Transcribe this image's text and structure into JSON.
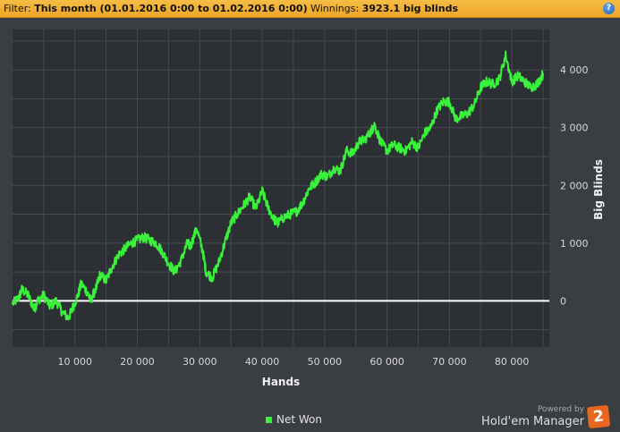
{
  "filter_bar": {
    "filter_label": "Filter:",
    "filter_value": "This month (01.01.2016 0:00 to 01.02.2016 0:00)",
    "winnings_label": "Winnings:",
    "winnings_value": "3923.1 big blinds",
    "help_glyph": "?"
  },
  "chart_data": {
    "type": "line",
    "xlabel": "Hands",
    "ylabel": "Big Blinds",
    "xlim": [
      0,
      86000
    ],
    "ylim": [
      -800,
      4700
    ],
    "x_ticks": [
      10000,
      20000,
      30000,
      40000,
      50000,
      60000,
      70000,
      80000
    ],
    "x_tick_labels": [
      "10 000",
      "20 000",
      "30 000",
      "40 000",
      "50 000",
      "60 000",
      "70 000",
      "80 000"
    ],
    "y_ticks": [
      0,
      1000,
      2000,
      3000,
      4000
    ],
    "y_tick_labels": [
      "0",
      "1 000",
      "2 000",
      "3 000",
      "4 000"
    ],
    "grid": true,
    "legend_position": "bottom-center",
    "series": [
      {
        "name": "Net Won",
        "color": "#39f23a",
        "x": [
          0,
          1000,
          1500,
          2500,
          3500,
          4000,
          5000,
          6000,
          7000,
          8000,
          9000,
          9500,
          10500,
          11000,
          12000,
          12500,
          13500,
          14000,
          15000,
          16000,
          17000,
          18000,
          19000,
          20000,
          21000,
          22000,
          23000,
          24000,
          25000,
          26000,
          27000,
          28000,
          28500,
          29500,
          30500,
          31000,
          32000,
          33000,
          34000,
          35000,
          36000,
          37000,
          38000,
          39000,
          40000,
          41000,
          42000,
          42500,
          43500,
          44500,
          45500,
          46500,
          47500,
          48500,
          49500,
          50500,
          51500,
          52500,
          53500,
          54500,
          55500,
          56500,
          57500,
          58000,
          59000,
          60000,
          61000,
          62000,
          63000,
          64000,
          65000,
          66000,
          67000,
          68000,
          69000,
          70000,
          71000,
          72000,
          73000,
          74000,
          75000,
          76000,
          77000,
          78000,
          79000,
          80000,
          81000,
          82000,
          83000,
          84000,
          85000
        ],
        "values": [
          -50,
          50,
          200,
          100,
          -150,
          0,
          100,
          -100,
          0,
          -200,
          -300,
          -150,
          100,
          300,
          150,
          0,
          250,
          450,
          350,
          600,
          800,
          900,
          1000,
          1050,
          1100,
          1050,
          1000,
          850,
          650,
          500,
          700,
          1000,
          950,
          1250,
          850,
          500,
          400,
          650,
          1000,
          1350,
          1500,
          1650,
          1800,
          1600,
          1900,
          1600,
          1400,
          1350,
          1450,
          1500,
          1550,
          1700,
          1950,
          2050,
          2200,
          2150,
          2300,
          2250,
          2600,
          2550,
          2750,
          2800,
          2950,
          3050,
          2750,
          2600,
          2700,
          2650,
          2600,
          2750,
          2650,
          2900,
          3000,
          3300,
          3450,
          3450,
          3150,
          3200,
          3250,
          3400,
          3700,
          3800,
          3750,
          3850,
          4250,
          3800,
          3900,
          3800,
          3700,
          3750,
          3930
        ]
      }
    ]
  },
  "branding": {
    "powered_by": "Powered by",
    "name": "Hold'em Manager",
    "logo_glyph": "2"
  }
}
